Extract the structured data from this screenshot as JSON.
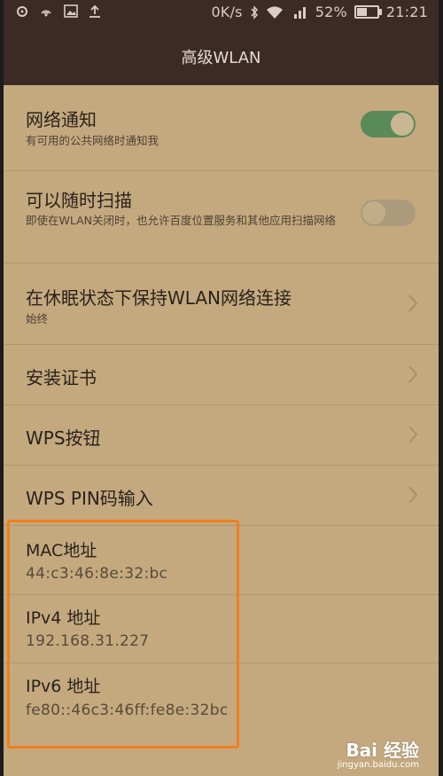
{
  "status_bar": {
    "network_speed": "0K/s",
    "battery_percent": "52%",
    "battery_level": 0.52,
    "time": "21:21",
    "icons": [
      "notification-dot-icon",
      "hotspot-icon",
      "gallery-icon",
      "upload-icon",
      "bluetooth-icon",
      "wifi-icon",
      "cellular-signal-icon",
      "battery-icon"
    ]
  },
  "app_bar": {
    "title": "高级WLAN"
  },
  "settings": {
    "network_notify": {
      "title": "网络通知",
      "subtitle": "有可用的公共网络时通知我",
      "enabled": true
    },
    "scan_always": {
      "title": "可以随时扫描",
      "subtitle": "即使在WLAN关闭时，也允许百度位置服务和其他应用扫描网络",
      "enabled": false
    },
    "keep_wifi_sleep": {
      "title": "在休眠状态下保持WLAN网络连接",
      "subtitle": "始终"
    },
    "install_cert": {
      "title": "安装证书"
    },
    "wps_button": {
      "title": "WPS按钮"
    },
    "wps_pin": {
      "title": "WPS PIN码输入"
    },
    "mac": {
      "title": "MAC地址",
      "value": "44:c3:46:8e:32:bc"
    },
    "ipv4": {
      "title": "IPv4 地址",
      "value": "192.168.31.227"
    },
    "ipv6": {
      "title": "IPv6 地址",
      "value": "fe80::46c3:46ff:fe8e:32bc"
    }
  },
  "colors": {
    "status_bar_bg": "#3c2a25",
    "screen_bg": "#c4a97f",
    "toggle_on": "#5a8a58",
    "highlight": "#f07f1c"
  },
  "watermark": {
    "logo": "Bai 经验",
    "url": "jingyan.baidu.com"
  }
}
